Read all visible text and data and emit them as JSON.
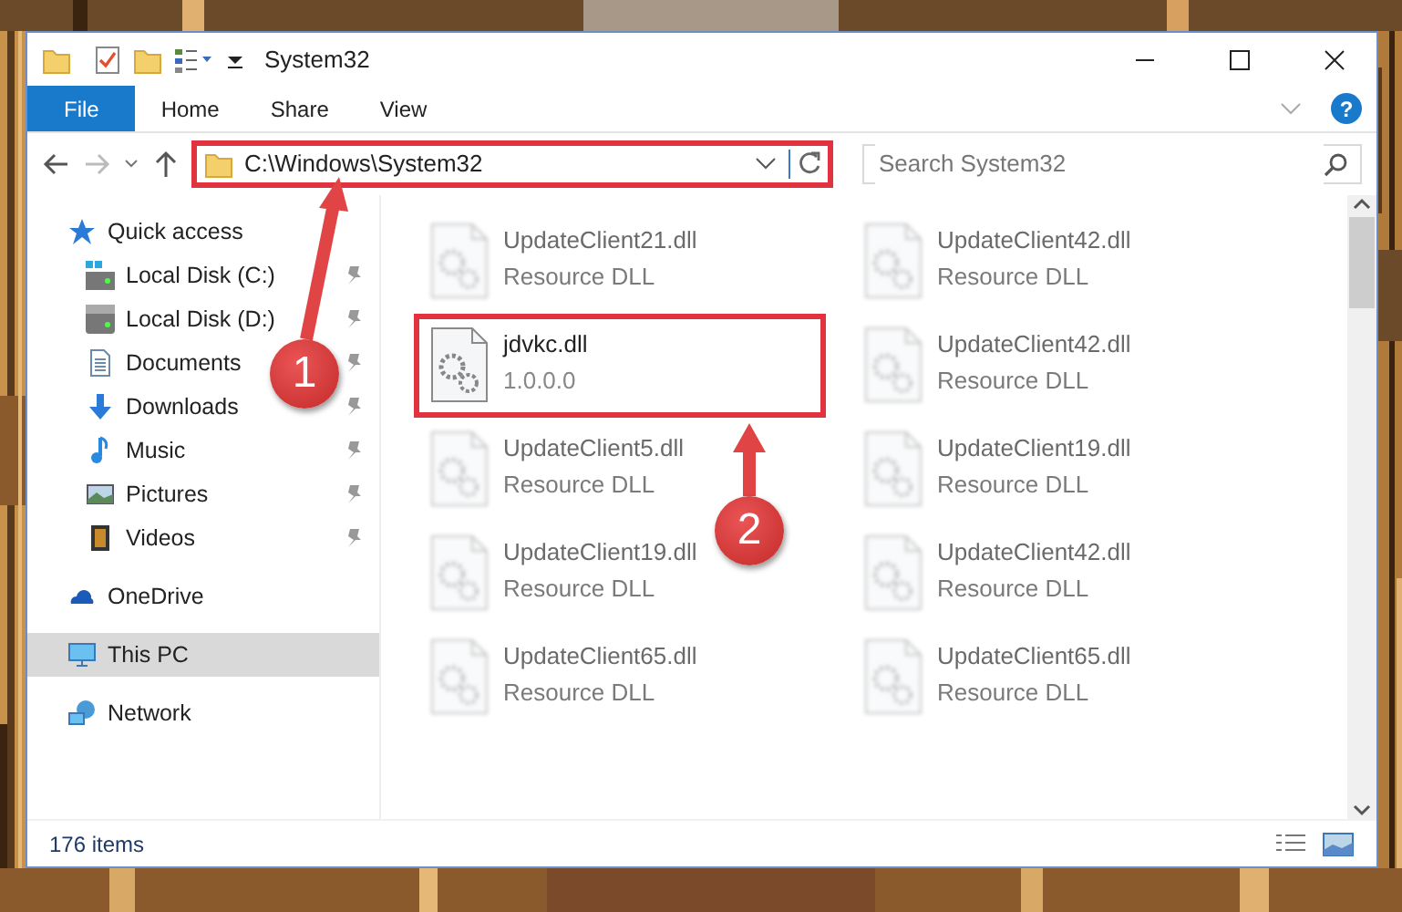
{
  "window": {
    "title": "System32"
  },
  "ribbon": {
    "tabs": [
      {
        "label": "File",
        "selected": true
      },
      {
        "label": "Home",
        "selected": false
      },
      {
        "label": "Share",
        "selected": false
      },
      {
        "label": "View",
        "selected": false
      }
    ],
    "help": "?"
  },
  "address_bar": {
    "path": "C:\\Windows\\System32",
    "highlighted": true
  },
  "search": {
    "placeholder": "Search System32"
  },
  "sidebar": {
    "items": [
      {
        "label": "Quick access",
        "selected": false,
        "children": [
          {
            "label": "Local Disk (C:)",
            "pinned": true,
            "selected": false
          },
          {
            "label": "Local Disk (D:)",
            "pinned": true,
            "selected": false
          },
          {
            "label": "Documents",
            "pinned": true,
            "selected": false
          },
          {
            "label": "Downloads",
            "pinned": true,
            "selected": false
          },
          {
            "label": "Music",
            "pinned": true,
            "selected": false
          },
          {
            "label": "Pictures",
            "pinned": true,
            "selected": false
          },
          {
            "label": "Videos",
            "pinned": true,
            "selected": false
          }
        ]
      },
      {
        "label": "OneDrive",
        "selected": false
      },
      {
        "label": "This PC",
        "selected": true
      },
      {
        "label": "Network",
        "selected": false
      }
    ]
  },
  "files": [
    {
      "name": "UpdateClient21.dll",
      "detail": "Resource DLL",
      "blurred": true,
      "highlighted": false
    },
    {
      "name": "UpdateClient42.dll",
      "detail": "Resource DLL",
      "blurred": true,
      "highlighted": false
    },
    {
      "name": "jdvkc.dll",
      "detail": "1.0.0.0",
      "blurred": false,
      "highlighted": true
    },
    {
      "name": "UpdateClient42.dll",
      "detail": "Resource DLL",
      "blurred": true,
      "highlighted": false
    },
    {
      "name": "UpdateClient5.dll",
      "detail": "Resource DLL",
      "blurred": true,
      "highlighted": false
    },
    {
      "name": "UpdateClient19.dll",
      "detail": "Resource DLL",
      "blurred": true,
      "highlighted": false
    },
    {
      "name": "UpdateClient19.dll",
      "detail": "Resource DLL",
      "blurred": true,
      "highlighted": false
    },
    {
      "name": "UpdateClient42.dll",
      "detail": "Resource DLL",
      "blurred": true,
      "highlighted": false
    },
    {
      "name": "UpdateClient65.dll",
      "detail": "Resource DLL",
      "blurred": true,
      "highlighted": false
    },
    {
      "name": "UpdateClient65.dll",
      "detail": "Resource DLL",
      "blurred": true,
      "highlighted": false
    }
  ],
  "status_bar": {
    "count": "176 items"
  },
  "annotations": [
    {
      "label": "1"
    },
    {
      "label": "2"
    }
  ]
}
